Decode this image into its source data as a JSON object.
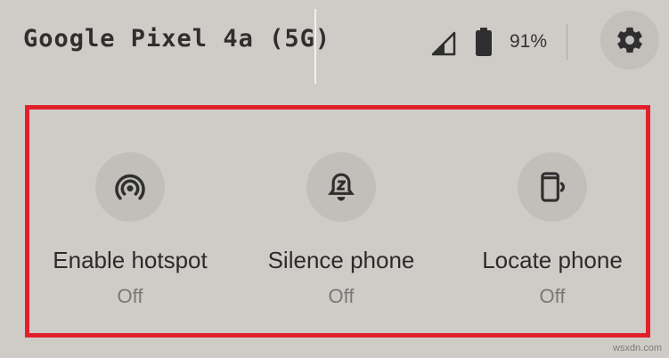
{
  "header": {
    "device_name": "Google Pixel 4a (5G)",
    "battery_percent": "91%",
    "icons": {
      "signal": "signal-strength-icon",
      "battery": "battery-icon",
      "settings": "gear-icon"
    }
  },
  "tiles": [
    {
      "label": "Enable hotspot",
      "state": "Off",
      "icon": "hotspot-icon"
    },
    {
      "label": "Silence phone",
      "state": "Off",
      "icon": "silent-bell-icon"
    },
    {
      "label": "Locate phone",
      "state": "Off",
      "icon": "locate-phone-icon"
    }
  ],
  "colors": {
    "background": "#cfccc8",
    "highlight": "#e1202b",
    "tile_circle": "#c2bfbb",
    "off_text": "#7a7775"
  },
  "watermark": "wsxdn.com"
}
